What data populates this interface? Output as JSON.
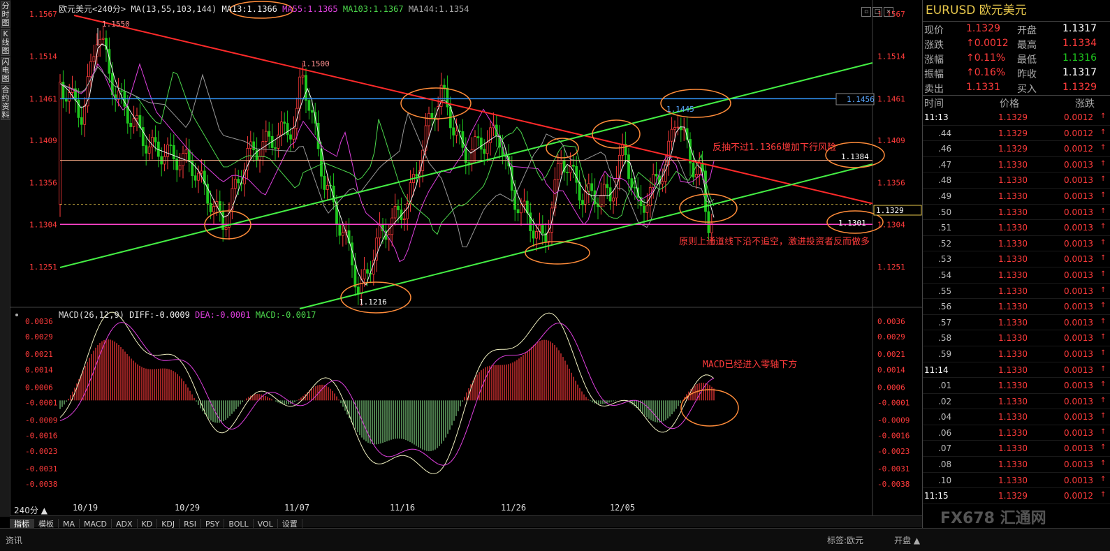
{
  "window": {
    "title": "欧元美元",
    "period": "240分"
  },
  "left_tabs": [
    "分时图",
    "K线图",
    "闪电图",
    "合约资料"
  ],
  "header": {
    "symbol_label": "欧元美元",
    "period": "<240分>",
    "ma_params": "MA(13,55,103,144)",
    "ma13": "MA13:1.1366",
    "ma55": "MA55:1.1365",
    "ma103": "MA103:1.1367",
    "ma144": "MA144:1.1354"
  },
  "macd_header": {
    "params": "MACD(26,12,9)",
    "diff": "DIFF:-0.0009",
    "dea": "DEA:-0.0001",
    "macd": "MACD:-0.0017"
  },
  "price_axis": [
    "1.1567",
    "1.1514",
    "1.1461",
    "1.1409",
    "1.1356",
    "1.1304",
    "1.1251"
  ],
  "macd_axis": [
    "0.0036",
    "0.0029",
    "0.0021",
    "0.0014",
    "0.0006",
    "-0.0001",
    "-0.0009",
    "-0.0016",
    "-0.0023",
    "-0.0031",
    "-0.0038"
  ],
  "date_labels": [
    "10/19",
    "10/29",
    "11/07",
    "11/16",
    "11/26",
    "12/05"
  ],
  "annotations": {
    "high": "1.1550",
    "peak": "1.1500",
    "low": "1.1216",
    "resistance": "1.1456",
    "level1445": "1.1445",
    "level1384": "1.1384",
    "level1301": "1.1301",
    "current": "1.1329",
    "note1": "反抽不过1.1366增加下行风险",
    "note2": "原则上通道线下沿不追空，激进投资者反而做多",
    "note3": "MACD已经进入零轴下方"
  },
  "bottom_tabs": [
    "指标",
    "模板",
    "MA",
    "MACD",
    "ADX",
    "KD",
    "KDJ",
    "RSI",
    "PSY",
    "BOLL",
    "VOL",
    "设置"
  ],
  "status": {
    "left": "资讯",
    "tag": "标签:欧元",
    "right": "开盘 ▲"
  },
  "quote": {
    "title": "EURUSD 欧元美元",
    "rows": [
      {
        "l1": "现价",
        "v1": "1.1329",
        "l2": "开盘",
        "v2": "1.1317"
      },
      {
        "l1": "涨跌",
        "v1": "↑0.0012",
        "l2": "最高",
        "v2": "1.1334"
      },
      {
        "l1": "涨幅",
        "v1": "↑0.11%",
        "l2": "最低",
        "v2": "1.1316"
      },
      {
        "l1": "振幅",
        "v1": "↑0.16%",
        "l2": "昨收",
        "v2": "1.1317"
      },
      {
        "l1": "卖出",
        "v1": "1.1331",
        "l2": "买入",
        "v2": "1.1329"
      }
    ],
    "tick_headers": [
      "时间",
      "价格",
      "涨跌"
    ],
    "ticks": [
      {
        "t": "11:13",
        "p": "1.1329",
        "c": "0.0012"
      },
      {
        "t": ".44",
        "p": "1.1329",
        "c": "0.0012"
      },
      {
        "t": ".46",
        "p": "1.1329",
        "c": "0.0012"
      },
      {
        "t": ".47",
        "p": "1.1330",
        "c": "0.0013"
      },
      {
        "t": ".48",
        "p": "1.1330",
        "c": "0.0013"
      },
      {
        "t": ".49",
        "p": "1.1330",
        "c": "0.0013"
      },
      {
        "t": ".50",
        "p": "1.1330",
        "c": "0.0013"
      },
      {
        "t": ".51",
        "p": "1.1330",
        "c": "0.0013"
      },
      {
        "t": ".52",
        "p": "1.1330",
        "c": "0.0013"
      },
      {
        "t": ".53",
        "p": "1.1330",
        "c": "0.0013"
      },
      {
        "t": ".54",
        "p": "1.1330",
        "c": "0.0013"
      },
      {
        "t": ".55",
        "p": "1.1330",
        "c": "0.0013"
      },
      {
        "t": ".56",
        "p": "1.1330",
        "c": "0.0013"
      },
      {
        "t": ".57",
        "p": "1.1330",
        "c": "0.0013"
      },
      {
        "t": ".58",
        "p": "1.1330",
        "c": "0.0013"
      },
      {
        "t": ".59",
        "p": "1.1330",
        "c": "0.0013"
      },
      {
        "t": "11:14",
        "p": "1.1330",
        "c": "0.0013"
      },
      {
        "t": ".01",
        "p": "1.1330",
        "c": "0.0013"
      },
      {
        "t": ".02",
        "p": "1.1330",
        "c": "0.0013"
      },
      {
        "t": ".04",
        "p": "1.1330",
        "c": "0.0013"
      },
      {
        "t": ".06",
        "p": "1.1330",
        "c": "0.0013"
      },
      {
        "t": ".07",
        "p": "1.1330",
        "c": "0.0013"
      },
      {
        "t": ".08",
        "p": "1.1330",
        "c": "0.0013"
      },
      {
        "t": ".10",
        "p": "1.1330",
        "c": "0.0013"
      },
      {
        "t": "11:15",
        "p": "1.1329",
        "c": "0.0012"
      }
    ]
  },
  "logo": "FX678 汇通网",
  "colors": {
    "up": "#ff3b3b",
    "down": "#1ec81e",
    "gold": "#e8c84c",
    "channel": "#44ee44",
    "trend": "#ff2a2a",
    "hline_blue": "#3399ff",
    "hline_pink": "#ff44cc",
    "ellipse": "#ff8c3a"
  }
}
